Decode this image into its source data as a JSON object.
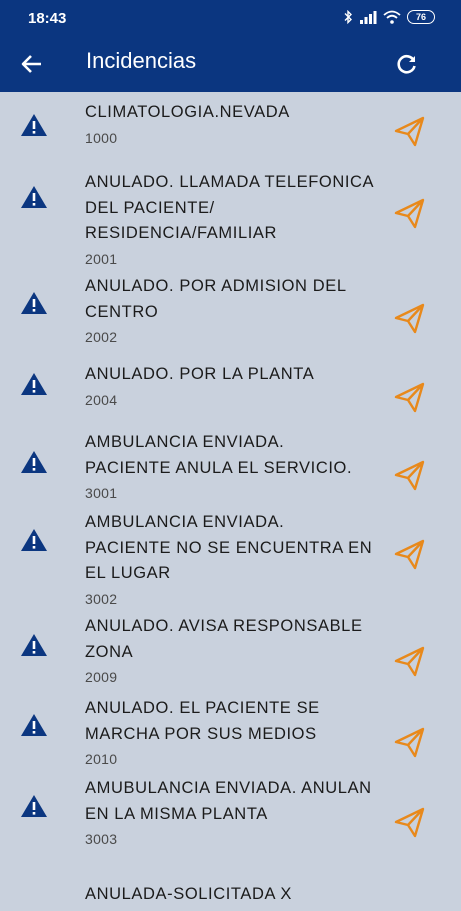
{
  "status": {
    "time": "18:43",
    "battery": "76"
  },
  "appbar": {
    "title": "Incidencias"
  },
  "items": [
    {
      "title": "CLIMATOLOGIA.NEVADA",
      "code": "1000"
    },
    {
      "title": "ANULADO. LLAMADA TELEFONICA DEL PACIENTE/ RESIDENCIA/FAMILIAR",
      "code": "2001"
    },
    {
      "title": "ANULADO. POR ADMISION DEL CENTRO",
      "code": "2002"
    },
    {
      "title": "ANULADO. POR LA PLANTA",
      "code": "2004"
    },
    {
      "title": "AMBULANCIA ENVIADA. PACIENTE ANULA EL SERVICIO.",
      "code": "3001"
    },
    {
      "title": "AMBULANCIA ENVIADA. PACIENTE NO SE ENCUENTRA EN EL LUGAR",
      "code": "3002"
    },
    {
      "title": "ANULADO. AVISA RESPONSABLE ZONA",
      "code": "2009"
    },
    {
      "title": "ANULADO. EL PACIENTE SE MARCHA POR SUS MEDIOS",
      "code": "2010"
    },
    {
      "title": "AMUBULANCIA ENVIADA. ANULAN EN LA MISMA PLANTA",
      "code": "3003"
    },
    {
      "title": "ANULADA-SOLICITADA X",
      "code": ""
    }
  ],
  "colors": {
    "primary": "#0b3680",
    "background": "#c9d1dd",
    "accent": "#e8891b"
  },
  "icons": {
    "back": "arrow-left-icon",
    "refresh": "refresh-icon",
    "warning": "warning-triangle-icon",
    "send": "send-paper-plane-icon"
  }
}
